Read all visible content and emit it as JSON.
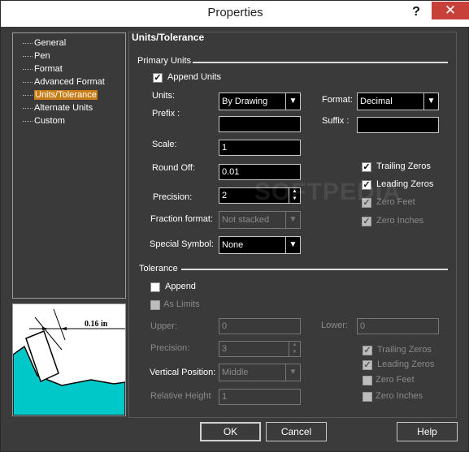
{
  "window": {
    "title": "Properties",
    "help_glyph": "?",
    "close_glyph": "✕"
  },
  "nav": {
    "items": [
      {
        "label": "General",
        "selected": false
      },
      {
        "label": "Pen",
        "selected": false
      },
      {
        "label": "Format",
        "selected": false
      },
      {
        "label": "Advanced Format",
        "selected": false
      },
      {
        "label": "Units/Tolerance",
        "selected": true
      },
      {
        "label": "Alternate Units",
        "selected": false
      },
      {
        "label": "Custom",
        "selected": false
      }
    ]
  },
  "preview": {
    "dimension_text": "0.16 in",
    "fill_color": "#00c8c8"
  },
  "panel": {
    "title": "Units/Tolerance"
  },
  "primary": {
    "heading": "Primary Units",
    "append_units": {
      "label": "Append Units",
      "checked": true
    },
    "units": {
      "label": "Units:",
      "value": "By Drawing"
    },
    "format": {
      "label": "Format:",
      "value": "Decimal"
    },
    "prefix": {
      "label": "Prefix :",
      "value": ""
    },
    "suffix": {
      "label": "Suffix :",
      "value": ""
    },
    "scale": {
      "label": "Scale:",
      "value": "1"
    },
    "round_off": {
      "label": "Round Off:",
      "value": "0.01"
    },
    "precision": {
      "label": "Precision:",
      "value": "2"
    },
    "fraction_format": {
      "label": "Fraction format:",
      "value": "Not stacked"
    },
    "special_symbol": {
      "label": "Special Symbol:",
      "value": "None"
    },
    "trailing_zeros": {
      "label": "Trailing Zeros",
      "checked": true
    },
    "leading_zeros": {
      "label": "Leading Zeros",
      "checked": true
    },
    "zero_feet": {
      "label": "Zero Feet",
      "checked": true
    },
    "zero_inches": {
      "label": "Zero Inches",
      "checked": true
    }
  },
  "tolerance": {
    "heading": "Tolerance",
    "append": {
      "label": "Append",
      "checked": false
    },
    "as_limits": {
      "label": "As Limits",
      "checked": false
    },
    "upper": {
      "label": "Upper:",
      "value": "0"
    },
    "lower": {
      "label": "Lower:",
      "value": "0"
    },
    "precision": {
      "label": "Precision:",
      "value": "3"
    },
    "vertical_position": {
      "label": "Vertical Position:",
      "value": "Middle"
    },
    "relative_height": {
      "label": "Relative Height",
      "value": "1"
    },
    "trailing_zeros": {
      "label": "Trailing Zeros",
      "checked": true
    },
    "leading_zeros": {
      "label": "Leading Zeros",
      "checked": true
    },
    "zero_feet": {
      "label": "Zero Feet",
      "checked": false
    },
    "zero_inches": {
      "label": "Zero Inches",
      "checked": false
    }
  },
  "buttons": {
    "ok": "OK",
    "cancel": "Cancel",
    "help": "Help"
  },
  "watermark": "SOFTPEDIA"
}
